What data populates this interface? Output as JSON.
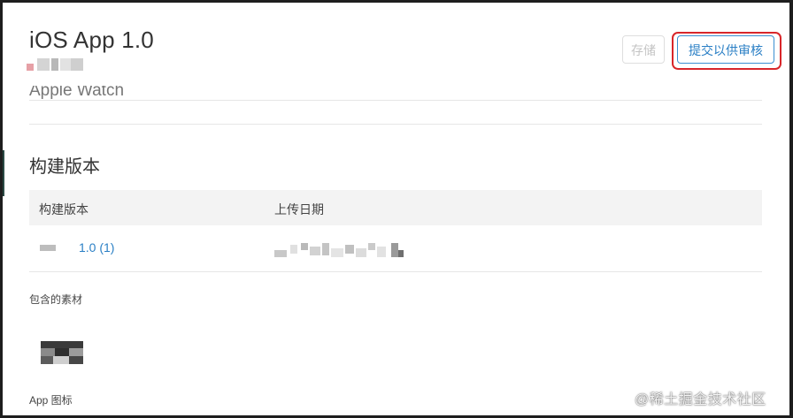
{
  "header": {
    "title": "iOS App 1.0",
    "scroll_hint": "Apple Watch"
  },
  "toolbar": {
    "save_label": "存储",
    "submit_label": "提交以供审核"
  },
  "builds": {
    "section_title": "构建版本",
    "columns": [
      "构建版本",
      "上传日期"
    ],
    "rows": [
      {
        "build": "1.0 (1)"
      }
    ]
  },
  "assets": {
    "label": "包含的素材",
    "icon_label": "App 图标"
  },
  "watermark": "@稀土掘金技术社区",
  "colors": {
    "link": "#2a7fc5",
    "highlight": "#d8262a",
    "header_bg": "#f3f3f3"
  }
}
